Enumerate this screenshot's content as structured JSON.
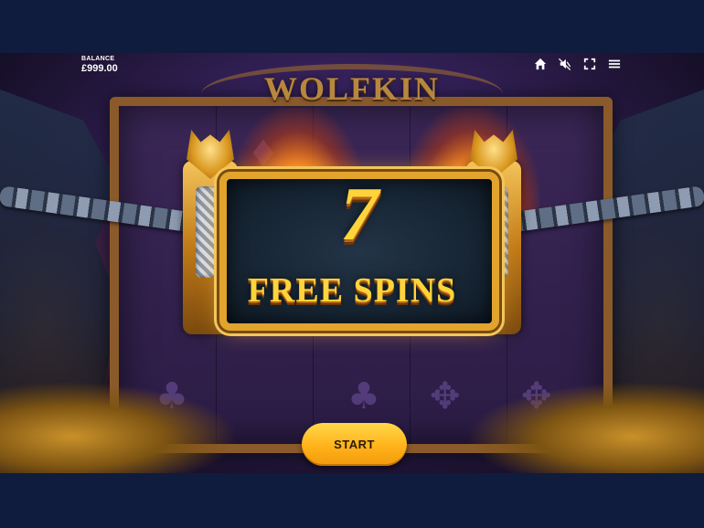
{
  "hud": {
    "balance_label": "BALANCE",
    "balance_value": "£999.00",
    "icons": [
      "home-icon",
      "sound-muted-icon",
      "fullscreen-icon",
      "menu-icon"
    ]
  },
  "game": {
    "logo": "WOLFKIN",
    "free_spins_count": "7",
    "free_spins_label": "FREE SPINS",
    "start_label": "START"
  },
  "colors": {
    "background": "#0f1c3d",
    "gold": "#ffd43a",
    "button": "#ffb21a"
  }
}
